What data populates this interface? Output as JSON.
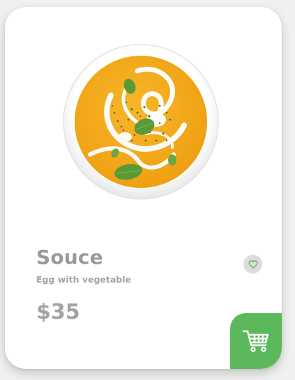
{
  "product": {
    "title": "Souce",
    "subtitle": "Egg with vegetable",
    "price": "$35",
    "image_icon": "soup-bowl-image"
  },
  "actions": {
    "favorite_icon": "heart-outline-icon",
    "cart_icon": "shopping-cart-icon"
  },
  "colors": {
    "card_background": "#ffffff",
    "cart_button": "#5cb85c",
    "favorite_background": "#dcdcdc",
    "favorite_heart": "#5cb85c",
    "text_gray": "#9a9a9a",
    "soup": "#f4a81c"
  }
}
